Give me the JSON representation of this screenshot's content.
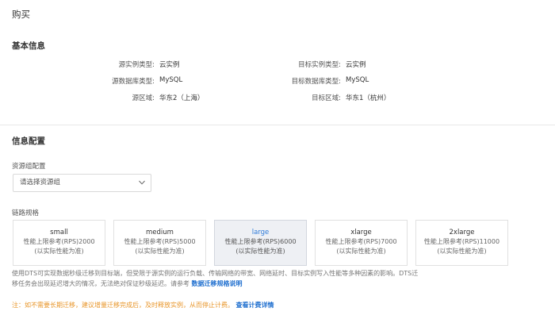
{
  "page": {
    "title": "购买"
  },
  "basic_info": {
    "section_title": "基本信息",
    "rows": [
      {
        "left_label": "源实例类型:",
        "left_value": "云实例",
        "right_label": "目标实例类型:",
        "right_value": "云实例"
      },
      {
        "left_label": "源数据库类型:",
        "left_value": "MySQL",
        "right_label": "目标数据库类型:",
        "right_value": "MySQL"
      },
      {
        "left_label": "源区域:",
        "left_value": "华东2（上海）",
        "right_label": "目标区域:",
        "right_value": "华东1（杭州）"
      }
    ]
  },
  "config": {
    "section_title": "信息配置",
    "resource_group_label": "资源组配置",
    "resource_group_placeholder": "请选择资源组",
    "spec_label": "链路规格",
    "specs": [
      {
        "name": "small",
        "line1": "性能上限参考(RPS)2000",
        "line2": "(以实际性能为准)",
        "selected": false
      },
      {
        "name": "medium",
        "line1": "性能上限参考(RPS)5000",
        "line2": "(以实际性能为准)",
        "selected": false
      },
      {
        "name": "large",
        "line1": "性能上限参考(RPS)6000",
        "line2": "(以实际性能为准)",
        "selected": true
      },
      {
        "name": "xlarge",
        "line1": "性能上限参考(RPS)7000",
        "line2": "(以实际性能为准)",
        "selected": false
      },
      {
        "name": "2xlarge",
        "line1": "性能上限参考(RPS)11000",
        "line2": "(以实际性能为准)",
        "selected": false
      }
    ],
    "description": "使用DTS可实现数据秒级迁移到目标端，但受限于源实例的运行负载、传输网络的带宽、网络延时、目标实例写入性能等多种因素的影响。DTS迁移任务会出现延迟增大的情况，无法绝对保证秒级延迟。请参考",
    "description_link": "数据迁移规格说明",
    "note": "注：如不需要长期迁移，建议增量迁移完成后，及时释放实例，从而停止计费。",
    "note_link": "查看计费详情"
  },
  "colors": {
    "accent": "#1f6fcf",
    "warning": "#e8962a",
    "selected_bg": "#eef0f4"
  },
  "icons": {
    "select_arrow": "chevron-down-icon"
  }
}
